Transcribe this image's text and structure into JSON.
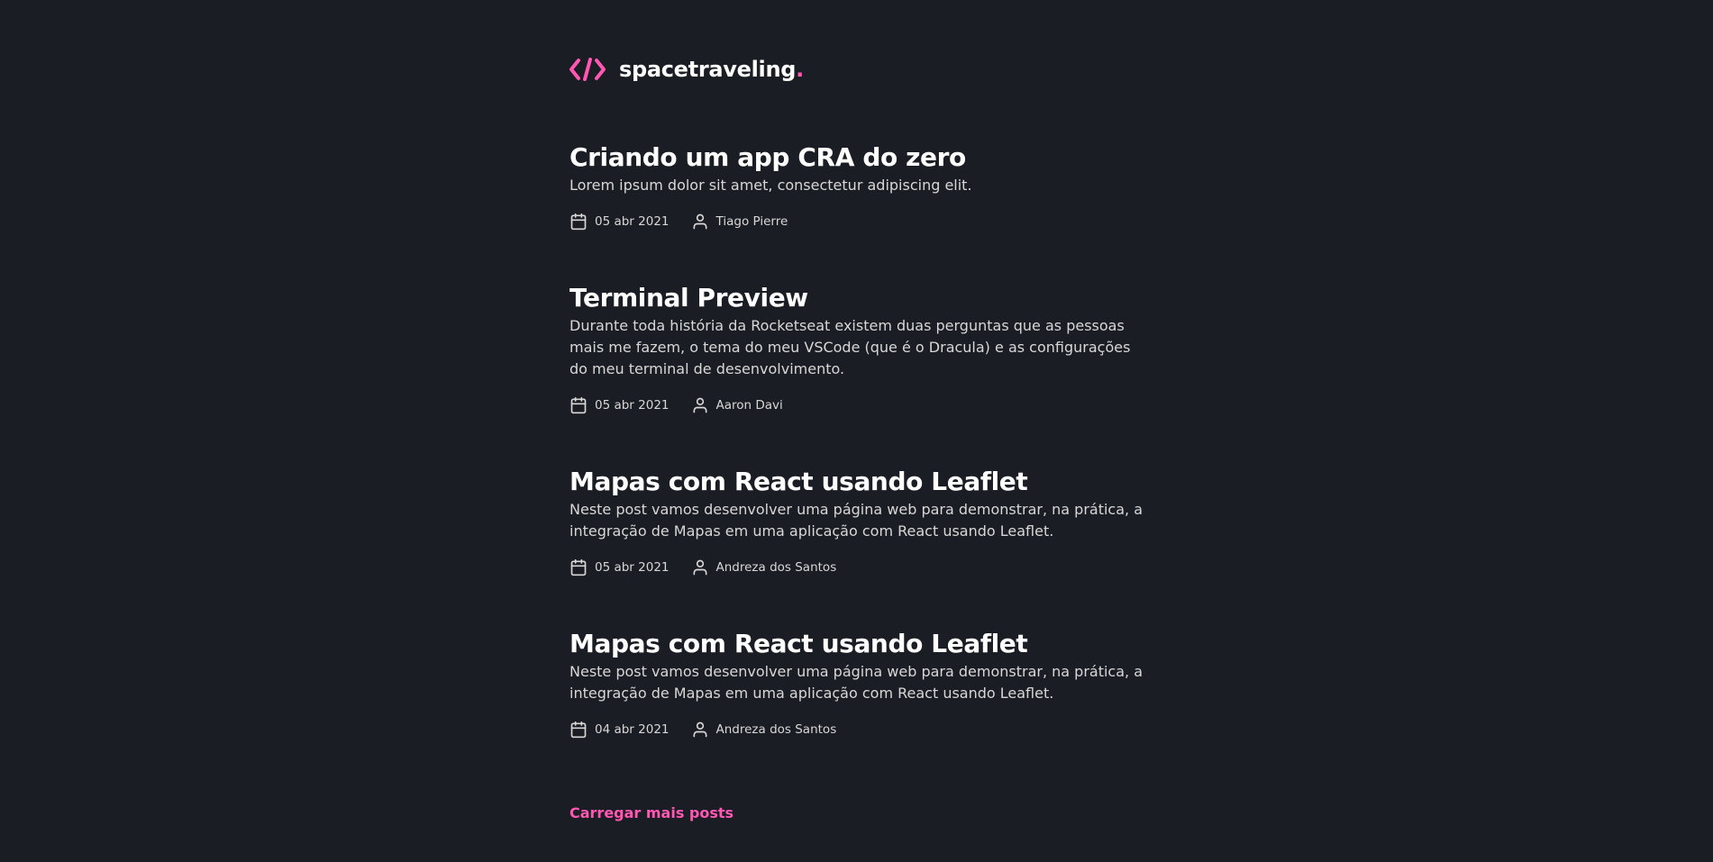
{
  "header": {
    "logo_text": "spacetraveling",
    "logo_dot": ".",
    "accent_color": "#ff57b2"
  },
  "posts": [
    {
      "title": "Criando um app CRA do zero",
      "subtitle": "Lorem ipsum dolor sit amet, consectetur adipiscing elit.",
      "date": "05 abr 2021",
      "author": "Tiago Pierre"
    },
    {
      "title": "Terminal Preview",
      "subtitle": "Durante toda história da Rocketseat existem duas perguntas que as pessoas mais me fazem, o tema do meu VSCode (que é o Dracula) e as configurações do meu terminal de desenvolvimento.",
      "date": "05 abr 2021",
      "author": "Aaron Davi"
    },
    {
      "title": "Mapas com React usando Leaflet",
      "subtitle": "Neste post vamos desenvolver uma página web para demonstrar, na prática, a integração de Mapas em uma aplicação com React usando Leaflet.",
      "date": "05 abr 2021",
      "author": "Andreza dos Santos"
    },
    {
      "title": "Mapas com React usando Leaflet",
      "subtitle": "Neste post vamos desenvolver uma página web para demonstrar, na prática, a integração de Mapas em uma aplicação com React usando Leaflet.",
      "date": "04 abr 2021",
      "author": "Andreza dos Santos"
    }
  ],
  "load_more_label": "Carregar mais posts",
  "icons": {
    "logo": "code-brackets-icon",
    "date": "calendar-icon",
    "author": "user-icon"
  }
}
